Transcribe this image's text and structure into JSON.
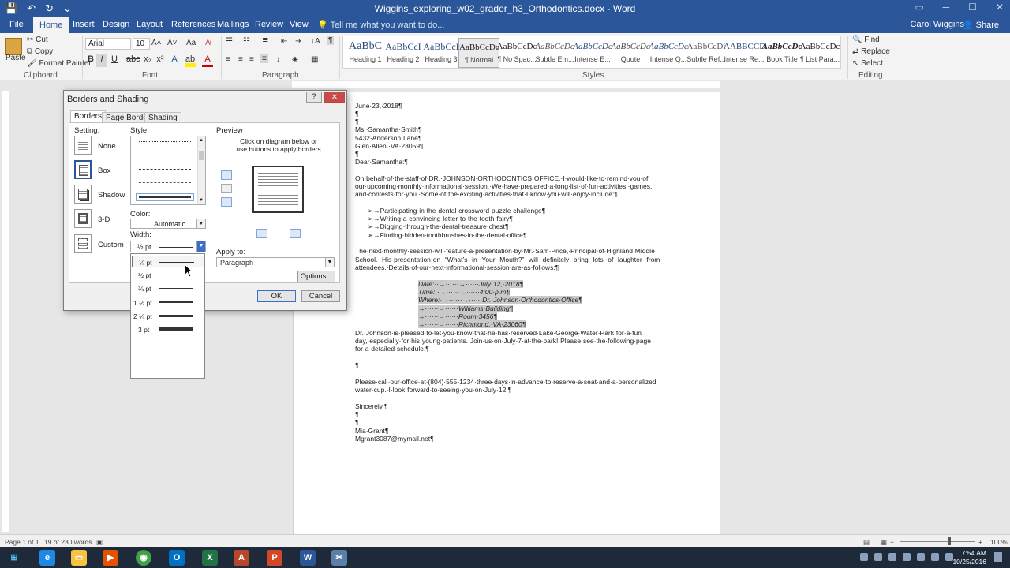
{
  "window": {
    "title": "Wiggins_exploring_w02_grader_h3_Orthodontics.docx - Word"
  },
  "ribbon_tabs": {
    "file": "File",
    "home": "Home",
    "insert": "Insert",
    "design": "Design",
    "layout": "Layout",
    "references": "References",
    "mailings": "Mailings",
    "review": "Review",
    "view": "View",
    "tell_me": "Tell me what you want to do...",
    "user": "Carol Wiggins",
    "share": "Share"
  },
  "clipboard": {
    "paste": "Paste",
    "cut": "Cut",
    "copy": "Copy",
    "format_painter": "Format Painter",
    "label": "Clipboard"
  },
  "font": {
    "name": "Arial",
    "size": "10",
    "label": "Font"
  },
  "paragraph": {
    "label": "Paragraph"
  },
  "styles": {
    "label": "Styles",
    "items": [
      {
        "sample": "AaBbC",
        "name": "Heading 1"
      },
      {
        "sample": "AaBbCcI",
        "name": "Heading 2"
      },
      {
        "sample": "AaBbCcI",
        "name": "Heading 3"
      },
      {
        "sample": "AaBbCcDc",
        "name": "¶ Normal"
      },
      {
        "sample": "AaBbCcDc",
        "name": "¶ No Spac..."
      },
      {
        "sample": "AaBbCcDc",
        "name": "Subtle Em..."
      },
      {
        "sample": "AaBbCcDc",
        "name": "Intense E..."
      },
      {
        "sample": "AaBbCcDc",
        "name": "Quote"
      },
      {
        "sample": "AaBbCcDc",
        "name": "Intense Q..."
      },
      {
        "sample": "AaBbCcDi",
        "name": "Subtle Ref..."
      },
      {
        "sample": "AABBCCD",
        "name": "Intense Re..."
      },
      {
        "sample": "AaBbCcDc",
        "name": "Book Title"
      },
      {
        "sample": "AaBbCcDc",
        "name": "¶ List Para..."
      }
    ]
  },
  "editing": {
    "find": "Find",
    "replace": "Replace",
    "select": "Select",
    "label": "Editing"
  },
  "dialog": {
    "title": "Borders and Shading",
    "tabs": {
      "borders": "Borders",
      "page_border": "Page Border",
      "shading": "Shading"
    },
    "setting_label": "Setting:",
    "settings": {
      "none": "None",
      "box": "Box",
      "shadow": "Shadow",
      "three_d": "3-D",
      "custom": "Custom"
    },
    "style_label": "Style:",
    "color_label": "Color:",
    "color_value": "Automatic",
    "width_label": "Width:",
    "width_value": "½ pt",
    "preview_label": "Preview",
    "preview_hint": "Click on diagram below or\nuse buttons to apply borders",
    "apply_to_label": "Apply to:",
    "apply_to_value": "Paragraph",
    "options": "Options...",
    "ok": "OK",
    "cancel": "Cancel",
    "width_options": [
      "¼ pt",
      "½ pt",
      "¾ pt",
      "1 ½ pt",
      "2 ¼ pt",
      "3 pt"
    ]
  },
  "document": {
    "lines": [
      "June·23,·2018¶",
      "¶",
      "¶",
      "Ms.·Samantha·Smith¶",
      "5432·Anderson·Lane¶",
      "Glen·Allen,·VA·23059¶",
      "¶",
      "Dear·Samantha:¶",
      "On·behalf·of·the·staff·of·DR.·JOHNSON·ORTHODONTICS·OFFICE,·I·would·like·to·remind·you·of",
      "our·upcoming·monthly·informational·session.·We·have·prepared·a·long·list·of·fun·activities,·games,",
      "and·contests·for·you.·Some·of·the·exciting·activities·that·I·know·you·will·enjoy·include:¶",
      "➢→Participating·in·the·dental·crossword·puzzle·challenge¶",
      "➢→Writing·a·convincing·letter·to·the·tooth·fairy¶",
      "➢→Digging·through·the·dental·treasure·chest¶",
      "➢→Finding·hidden·toothbrushes·in·the·dental·office¶",
      "The·next·monthly·session·will·feature·a·presentation·by·Mr.·Sam·Price,·Principal·of·Highland·Middle",
      "School.··His·presentation·on··“What’s··in··Your··Mouth?”··will··definitely··bring··lots··of··laughter··from",
      "attendees.·Details·of·our·next·informational·session·are·as·follows:¶",
      "Date:··→······→······July·12,·2018¶",
      "Time:··→······→······4:00·p.m¶",
      "Where:·→······→······Dr.·Johnson·Orthodontics·Office¶",
      "→······→······Williams·Building¶",
      "→······→······Room·3456¶",
      "→······→······Richmond,·VA·23060¶",
      "Dr.·Johnson·is·pleased·to·let·you·know·that·he·has·reserved·Lake·George·Water·Park·for·a·fun",
      "day,·especially·for·his·young·patients.·Join·us·on·July·7·at·the·park!·Please·see·the·following·page",
      "for·a·detailed·schedule.¶",
      "¶",
      "Please·call·our·office·at·(804)·555-1234·three·days·in·advance·to·reserve·a·seat·and·a·personalized",
      "water·cup.·I·look·forward·to·seeing·you·on·July·12.¶",
      "Sincerely,¶",
      "¶",
      "¶",
      "Mia·Grant¶",
      "Mgrant3087@mymail.net¶"
    ]
  },
  "statusbar": {
    "page": "Page 1 of 1",
    "words": "19 of 230 words",
    "zoom": "100%"
  },
  "taskbar": {
    "time": "7:54 AM",
    "date": "10/25/2016"
  }
}
